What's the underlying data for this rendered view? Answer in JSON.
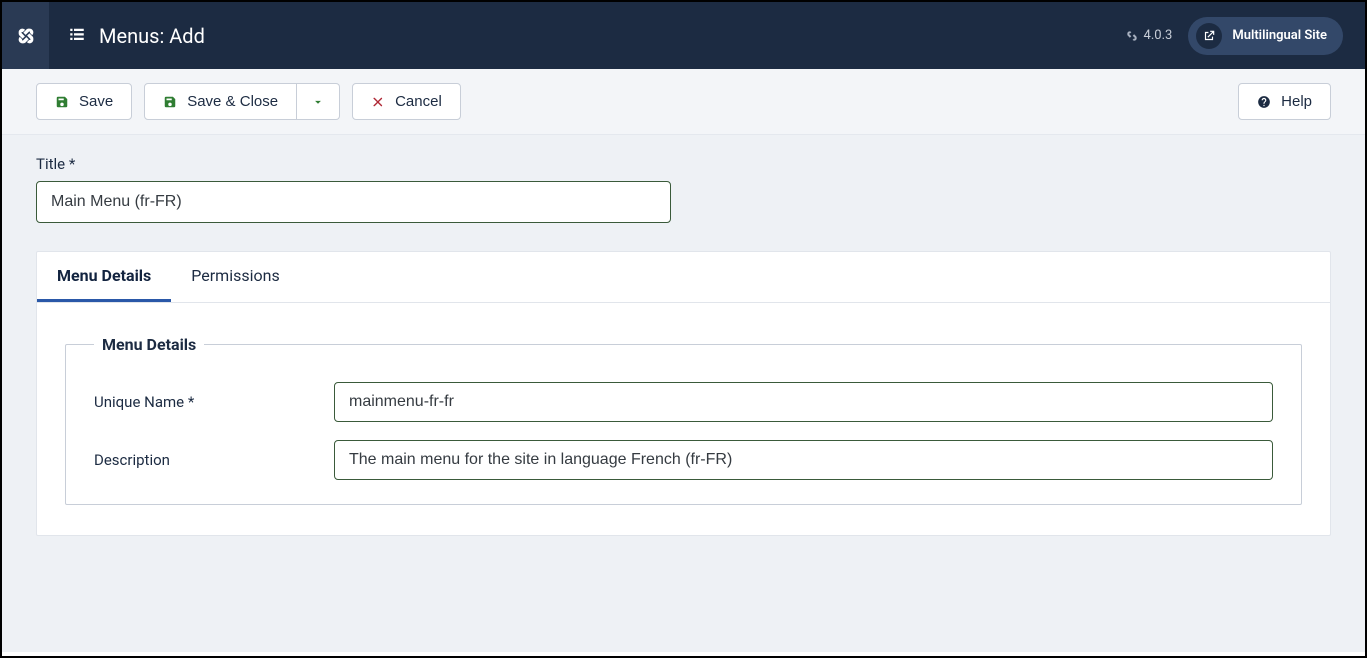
{
  "header": {
    "page_title": "Menus: Add",
    "version": "4.0.3",
    "site_link_label": "Multilingual Site"
  },
  "toolbar": {
    "save": "Save",
    "save_close": "Save & Close",
    "cancel": "Cancel",
    "help": "Help"
  },
  "form": {
    "title_label": "Title *",
    "title_value": "Main Menu (fr-FR)"
  },
  "tabs": {
    "menu_details": "Menu Details",
    "permissions": "Permissions"
  },
  "fieldset": {
    "legend": "Menu Details",
    "unique_name_label": "Unique Name *",
    "unique_name_value": "mainmenu-fr-fr",
    "description_label": "Description",
    "description_value": "The main menu for the site in language French (fr-FR)"
  }
}
